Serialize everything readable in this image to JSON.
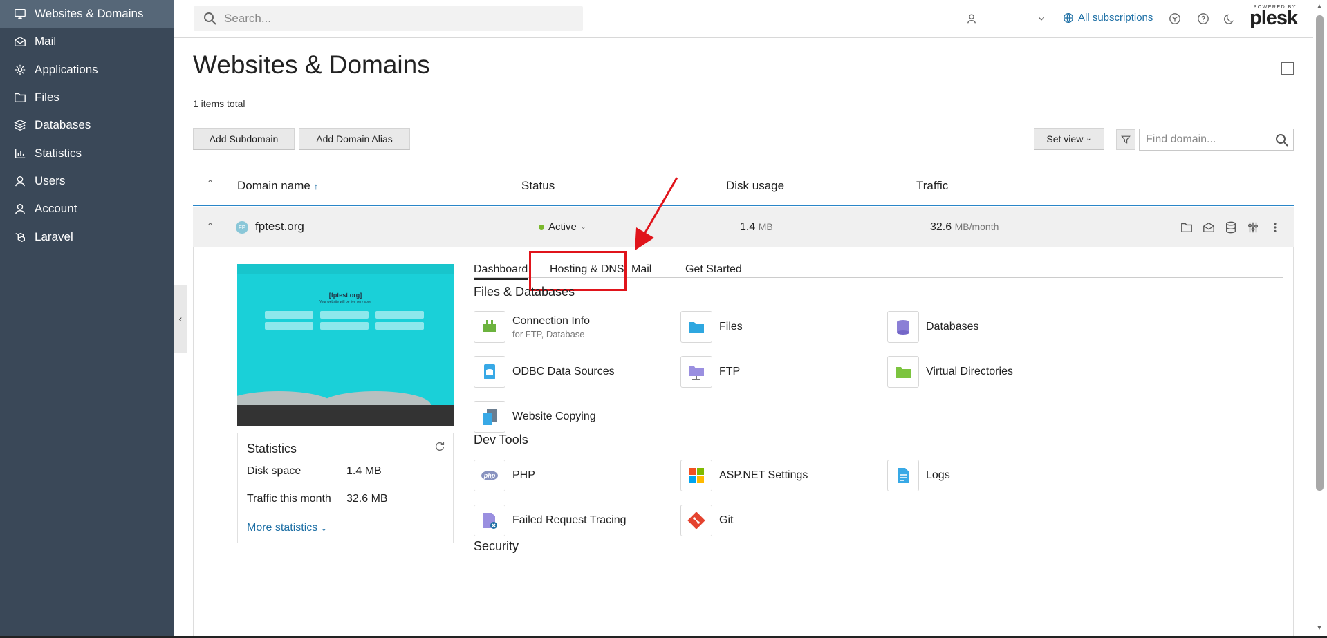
{
  "sidebar": {
    "items": [
      {
        "label": "Websites & Domains",
        "icon": "monitor-icon"
      },
      {
        "label": "Mail",
        "icon": "envelope-icon"
      },
      {
        "label": "Applications",
        "icon": "gear-icon"
      },
      {
        "label": "Files",
        "icon": "folder-icon"
      },
      {
        "label": "Databases",
        "icon": "database-icon"
      },
      {
        "label": "Statistics",
        "icon": "bar-chart-icon"
      },
      {
        "label": "Users",
        "icon": "user-icon"
      },
      {
        "label": "Account",
        "icon": "account-icon"
      },
      {
        "label": "Laravel",
        "icon": "laravel-icon"
      }
    ]
  },
  "topbar": {
    "search_placeholder": "Search...",
    "subscriptions_label": "All subscriptions",
    "brand_powered": "POWERED BY",
    "brand_name": "plesk"
  },
  "page": {
    "title": "Websites & Domains",
    "items_total": "1 items total",
    "add_subdomain": "Add Subdomain",
    "add_alias": "Add Domain Alias",
    "set_view": "Set view",
    "find_placeholder": "Find domain..."
  },
  "table": {
    "columns": [
      "Domain name",
      "Status",
      "Disk usage",
      "Traffic"
    ],
    "row": {
      "domain": "fptest.org",
      "status": "Active",
      "disk_value": "1.4",
      "disk_unit": "MB",
      "traffic_value": "32.6",
      "traffic_unit": "MB/month"
    }
  },
  "preview": {
    "site_title": "[fptest.org]",
    "site_subtitle": "Your website will be live very soon"
  },
  "stats": {
    "title": "Statistics",
    "disk_label": "Disk space",
    "disk_value": "1.4 MB",
    "traffic_label": "Traffic this month",
    "traffic_value": "32.6 MB",
    "more": "More statistics"
  },
  "tabs": [
    "Dashboard",
    "Hosting & DNS",
    "Mail",
    "Get Started"
  ],
  "sections": {
    "files_db": "Files & Databases",
    "dev_tools": "Dev Tools",
    "security": "Security"
  },
  "tools": {
    "connection_info": "Connection Info",
    "connection_info_sub": "for FTP, Database",
    "files": "Files",
    "databases": "Databases",
    "odbc": "ODBC Data Sources",
    "ftp": "FTP",
    "virtual_dirs": "Virtual Directories",
    "website_copying": "Website Copying",
    "php": "PHP",
    "aspnet": "ASP.NET Settings",
    "logs": "Logs",
    "failed_request": "Failed Request Tracing",
    "git": "Git"
  },
  "colors": {
    "sidebar_bg": "#3a4858",
    "sidebar_active": "#566778",
    "link": "#1d6fa5",
    "highlight": "#e0141b",
    "status_active": "#7ab82c"
  }
}
